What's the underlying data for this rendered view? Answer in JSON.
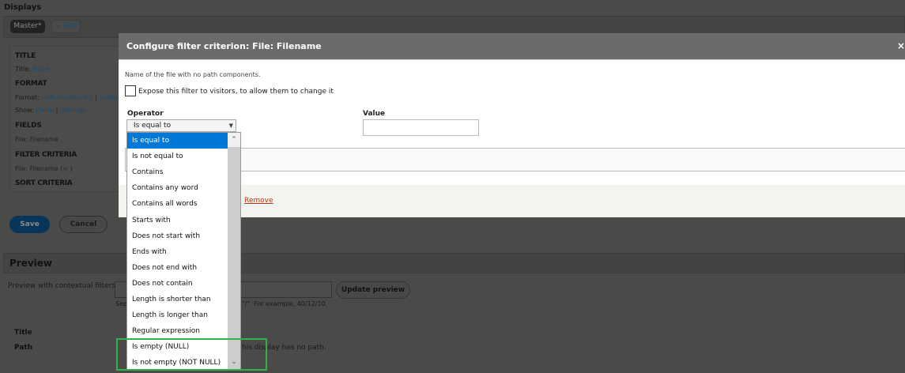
{
  "page": {
    "displays_title": "Displays",
    "master_tab": "Master*",
    "add_button": "+ Add",
    "sections": {
      "title_heading": "TITLE",
      "title_label": "Title:",
      "title_value": "None",
      "format_heading": "FORMAT",
      "format_label": "Format:",
      "format_value": "Unformatted list",
      "format_settings": "Settings",
      "show_label": "Show:",
      "show_value": "Fields",
      "show_settings": "Settings",
      "fields_heading": "FIELDS",
      "field_item": "File: Filename",
      "filter_heading": "FILTER CRITERIA",
      "filter_item": "File: Filename (= )",
      "sort_heading": "SORT CRITERIA"
    },
    "save": "Save",
    "cancel": "Cancel",
    "preview": {
      "heading": "Preview",
      "contextual_label": "Preview with contextual filters:",
      "update_button": "Update preview",
      "help_start": "Sep",
      "help_end": "\"/\". For example, 40/12/10.",
      "title_label": "Title",
      "path_label": "Path",
      "path_text": "his display has no path."
    }
  },
  "modal": {
    "title": "Configure filter criterion: File: Filename",
    "close": "×",
    "description": "Name of the file with no path components.",
    "expose_label": "Expose this filter to visitors, to allow them to change it",
    "operator_label": "Operator",
    "operator_value": "Is equal to",
    "value_label": "Value",
    "value": "",
    "remove": "Remove",
    "options": [
      "Is equal to",
      "Is not equal to",
      "Contains",
      "Contains any word",
      "Contains all words",
      "Starts with",
      "Does not start with",
      "Ends with",
      "Does not end with",
      "Does not contain",
      "Length is shorter than",
      "Length is longer than",
      "Regular expression",
      "Is empty (NULL)",
      "Is not empty (NOT NULL)"
    ]
  },
  "colors": {
    "highlight": "#0078d7",
    "annotation": "#2db34a",
    "remove": "#c0360c"
  }
}
